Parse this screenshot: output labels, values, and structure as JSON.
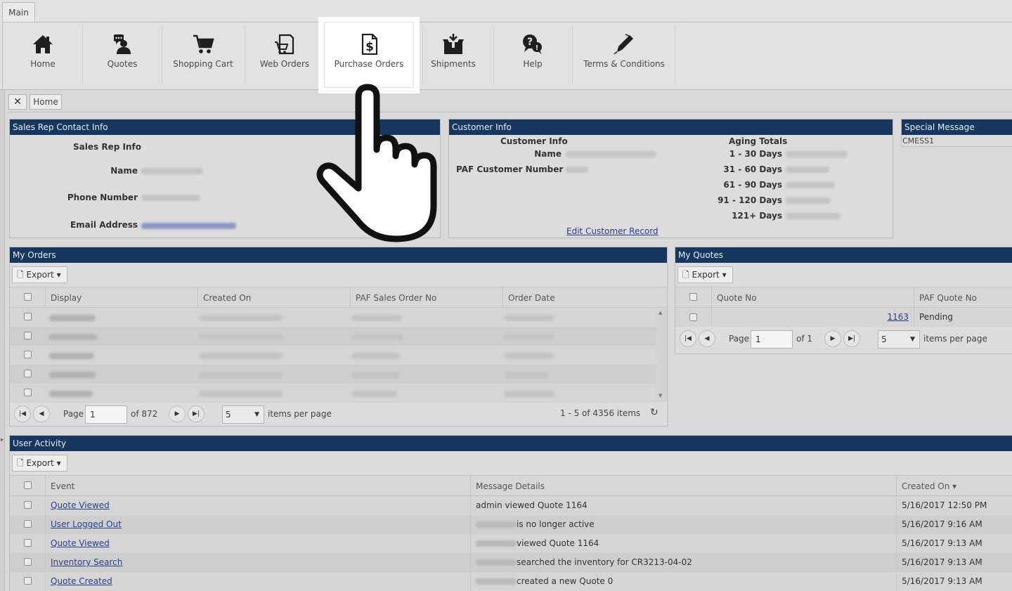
{
  "ribbon": {
    "tab_label": "Main",
    "buttons": [
      {
        "label": "Home",
        "icon": "home-icon"
      },
      {
        "label": "Quotes",
        "icon": "quotes-icon"
      },
      {
        "label": "Shopping Cart",
        "icon": "shopping-cart-icon"
      },
      {
        "label": "Web Orders",
        "icon": "web-orders-icon"
      },
      {
        "label": "Purchase Orders",
        "icon": "purchase-orders-icon"
      },
      {
        "label": "Shipments",
        "icon": "shipments-icon"
      },
      {
        "label": "Help",
        "icon": "help-icon"
      },
      {
        "label": "Terms & Conditions",
        "icon": "terms-icon"
      }
    ]
  },
  "breadcrumb": {
    "close_glyph": "✕",
    "home_label": "Home"
  },
  "sales_rep": {
    "title": "Sales Rep Contact Info",
    "heading": "Sales Rep Info",
    "name_label": "Name",
    "phone_label": "Phone Number",
    "email_label": "Email Address"
  },
  "customer": {
    "title": "Customer Info",
    "heading": "Customer Info",
    "name_label": "Name",
    "paf_label": "PAF Customer Number",
    "aging_heading": "Aging Totals",
    "aging": [
      "1 - 30 Days",
      "31 - 60 Days",
      "61 - 90 Days",
      "91 - 120 Days",
      "121+ Days"
    ],
    "edit_link": "Edit Customer Record"
  },
  "special": {
    "title": "Special Message",
    "text": "CMESS1"
  },
  "orders": {
    "title": "My Orders",
    "export_label": "Export",
    "columns": [
      "Display",
      "Created On",
      "PAF Sales Order No",
      "Order Date"
    ],
    "row_count": 5,
    "pager": {
      "page_label": "Page",
      "page_value": "1",
      "of_text": "of 872",
      "size": "5",
      "items_per_page": "items per page",
      "summary": "1 - 5 of 4356 items"
    }
  },
  "quotes": {
    "title": "My Quotes",
    "export_label": "Export",
    "columns": [
      "Quote No",
      "PAF Quote No"
    ],
    "rows": [
      {
        "quote_no": "1163",
        "paf": "Pending"
      }
    ],
    "pager": {
      "page_label": "Page",
      "page_value": "1",
      "of_text": "of 1",
      "size": "5",
      "items_per_page": "items per page"
    }
  },
  "activity": {
    "title": "User Activity",
    "export_label": "Export",
    "columns": [
      "Event",
      "Message Details",
      "Created On ▾"
    ],
    "rows": [
      {
        "event": "Quote Viewed",
        "message": "admin viewed Quote 1164",
        "created": "5/16/2017 12:50 PM"
      },
      {
        "event": "User Logged Out",
        "message": "is no longer active",
        "created": "5/16/2017 9:16 AM"
      },
      {
        "event": "Quote Viewed",
        "message": "viewed Quote 1164",
        "created": "5/16/2017 9:13 AM"
      },
      {
        "event": "Inventory Search",
        "message": "searched the inventory for CR3213-04-02",
        "created": "5/16/2017 9:13 AM"
      },
      {
        "event": "Quote Created",
        "message": "created a new Quote 0",
        "created": "5/16/2017 9:13 AM"
      }
    ]
  },
  "colors": {
    "header_navy": "#173660",
    "link_blue": "#2a3f8c",
    "background": "#d9d9d9"
  }
}
